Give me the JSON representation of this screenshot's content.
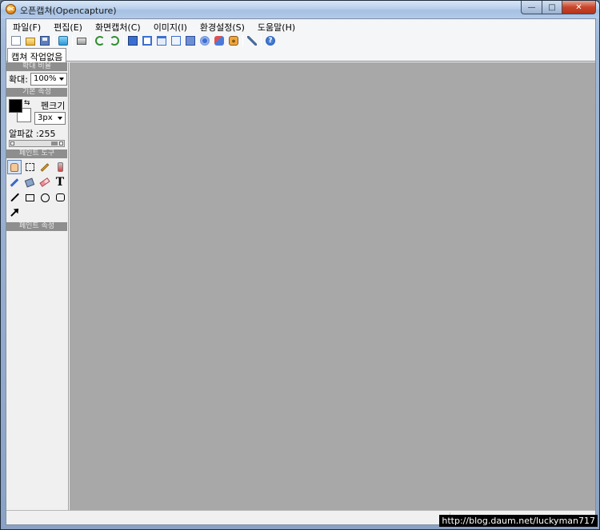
{
  "window": {
    "title": "오픈캡쳐(Opencapture)",
    "app_icon_glyph": "oc",
    "minimize_glyph": "—",
    "maximize_glyph": "□",
    "close_glyph": "✕"
  },
  "menubar": {
    "items": [
      {
        "label": "파일(F)"
      },
      {
        "label": "편집(E)"
      },
      {
        "label": "화면캡처(C)"
      },
      {
        "label": "이미지(I)"
      },
      {
        "label": "환경설정(S)"
      },
      {
        "label": "도움말(H)"
      }
    ]
  },
  "toolbar": {
    "buttons": [
      {
        "icon": "new-document-icon"
      },
      {
        "icon": "open-folder-icon"
      },
      {
        "icon": "save-icon"
      },
      {
        "icon": "twitter-icon"
      },
      {
        "icon": "print-icon"
      },
      {
        "icon": "undo-icon"
      },
      {
        "icon": "redo-icon"
      },
      {
        "icon": "capture-region-icon"
      },
      {
        "icon": "capture-window-icon"
      },
      {
        "icon": "capture-active-window-icon"
      },
      {
        "icon": "capture-scroll-icon"
      },
      {
        "icon": "capture-fullscreen-icon"
      },
      {
        "icon": "capture-fixed-size-icon"
      },
      {
        "icon": "capture-multi-icon"
      },
      {
        "icon": "capture-camera-icon"
      },
      {
        "icon": "settings-wrench-icon"
      },
      {
        "icon": "help-icon"
      }
    ],
    "help_glyph": "?"
  },
  "tabs": [
    {
      "label": "캡쳐 작업없음"
    }
  ],
  "sidebar": {
    "zoom_section": {
      "header": "확대 비율",
      "label": "확대:",
      "value": "100%"
    },
    "basic_section": {
      "header": "기본 속성",
      "swap_glyph": "⇆",
      "pen_size_label": "펜크기",
      "pen_size_value": "3px",
      "alpha_label": "알파값 :255",
      "alpha_value": 255
    },
    "paint_tools_section": {
      "header": "페인트 도구",
      "text_tool_glyph": "T"
    },
    "paint_props_section": {
      "header": "페인트 속성"
    }
  },
  "colors": {
    "foreground": "#000000",
    "background": "#ffffff",
    "canvas": "#a8a8a8"
  },
  "watermark": "http://blog.daum.net/luckyman717"
}
